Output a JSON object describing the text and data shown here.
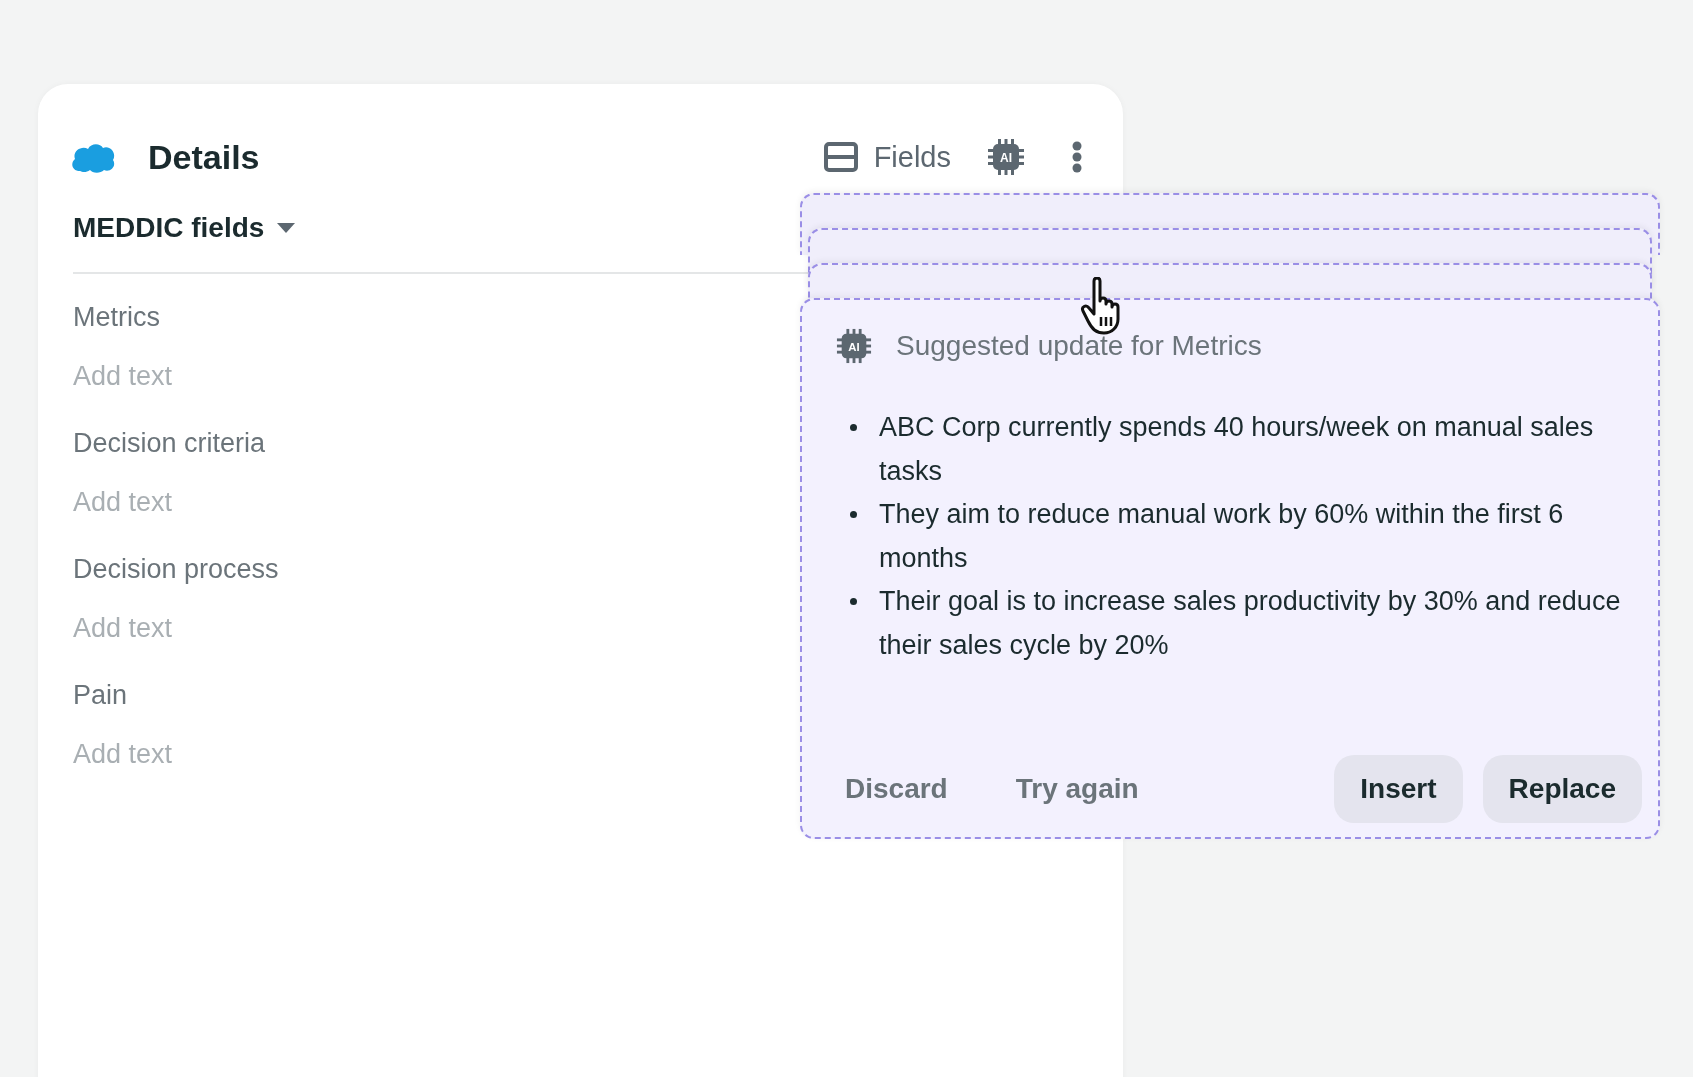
{
  "header": {
    "title": "Details",
    "fields_button": "Fields",
    "ai_badge": "AI"
  },
  "section": {
    "title": "MEDDIC fields"
  },
  "fields": [
    {
      "label": "Metrics",
      "placeholder": "Add text"
    },
    {
      "label": "Decision criteria",
      "placeholder": "Add text"
    },
    {
      "label": "Decision process",
      "placeholder": "Add text"
    },
    {
      "label": "Pain",
      "placeholder": "Add text"
    }
  ],
  "suggestion": {
    "ai_badge": "AI",
    "title": "Suggested update for Metrics",
    "bullets": [
      "ABC Corp currently spends 40 hours/week on manual sales tasks",
      "They aim to reduce manual work by 60% within the first 6 months",
      "Their goal is to increase sales productivity by 30% and reduce their sales cycle by 20%"
    ],
    "actions": [
      {
        "label": "Discard",
        "kind": "text"
      },
      {
        "label": "Try again",
        "kind": "text"
      },
      {
        "label": "Insert",
        "kind": "filled"
      },
      {
        "label": "Replace",
        "kind": "filled"
      }
    ]
  }
}
